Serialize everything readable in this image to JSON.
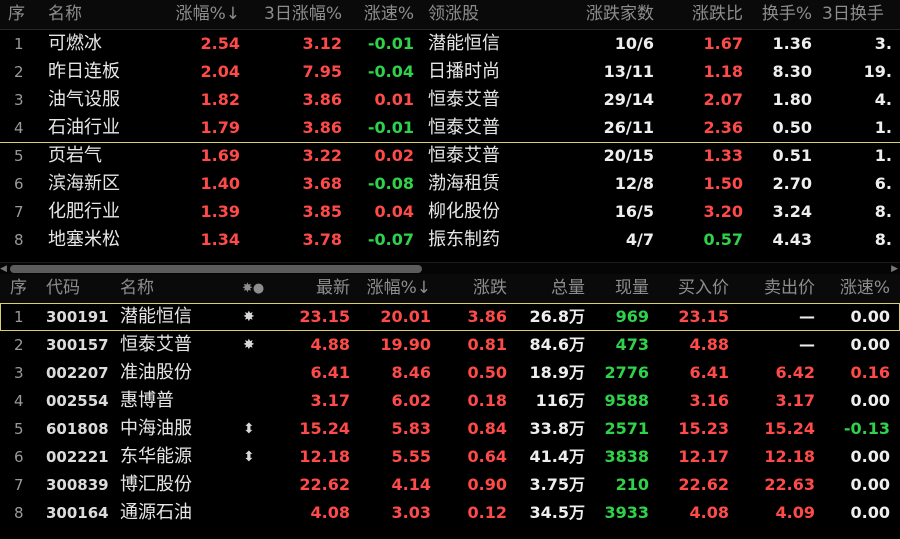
{
  "sector_table": {
    "headers": {
      "idx": "序",
      "name": "名称",
      "chg": "涨幅%↓",
      "chg3": "3日涨幅%",
      "speed": "涨速%",
      "leader": "领涨股",
      "updown": "涨跌家数",
      "ratio": "涨跌比",
      "turnover": "换手%",
      "turnover3": "3日换手"
    },
    "rows": [
      {
        "idx": "1",
        "name": "可燃冰",
        "chg": "2.54",
        "chg3": "3.12",
        "speed": "-0.01",
        "leader": "潜能恒信",
        "updown": "10/6",
        "ratio": "1.67",
        "turnover": "1.36",
        "turnover3": "3."
      },
      {
        "idx": "2",
        "name": "昨日连板",
        "chg": "2.04",
        "chg3": "7.95",
        "speed": "-0.04",
        "leader": "日播时尚",
        "updown": "13/11",
        "ratio": "1.18",
        "turnover": "8.30",
        "turnover3": "19."
      },
      {
        "idx": "3",
        "name": "油气设服",
        "chg": "1.82",
        "chg3": "3.86",
        "speed": "0.01",
        "leader": "恒泰艾普",
        "updown": "29/14",
        "ratio": "2.07",
        "turnover": "1.80",
        "turnover3": "4."
      },
      {
        "idx": "4",
        "name": "石油行业",
        "chg": "1.79",
        "chg3": "3.86",
        "speed": "-0.01",
        "leader": "恒泰艾普",
        "updown": "26/11",
        "ratio": "2.36",
        "turnover": "0.50",
        "turnover3": "1."
      },
      {
        "idx": "5",
        "name": "页岩气",
        "chg": "1.69",
        "chg3": "3.22",
        "speed": "0.02",
        "leader": "恒泰艾普",
        "updown": "20/15",
        "ratio": "1.33",
        "turnover": "0.51",
        "turnover3": "1."
      },
      {
        "idx": "6",
        "name": "滨海新区",
        "chg": "1.40",
        "chg3": "3.68",
        "speed": "-0.08",
        "leader": "渤海租赁",
        "updown": "12/8",
        "ratio": "1.50",
        "turnover": "2.70",
        "turnover3": "6."
      },
      {
        "idx": "7",
        "name": "化肥行业",
        "chg": "1.39",
        "chg3": "3.85",
        "speed": "0.04",
        "leader": "柳化股份",
        "updown": "16/5",
        "ratio": "3.20",
        "turnover": "3.24",
        "turnover3": "8."
      },
      {
        "idx": "8",
        "name": "地塞米松",
        "chg": "1.34",
        "chg3": "3.78",
        "speed": "-0.07",
        "leader": "振东制药",
        "updown": "4/7",
        "ratio": "0.57",
        "turnover": "4.43",
        "turnover3": "8."
      }
    ]
  },
  "stock_table": {
    "headers": {
      "idx": "序",
      "code": "代码",
      "name": "名称",
      "flag": "✸●",
      "last": "最新",
      "chg": "涨幅%↓",
      "change": "涨跌",
      "vol": "总量",
      "cur": "现量",
      "bid": "买入价",
      "ask": "卖出价",
      "speed": "涨速%"
    },
    "rows": [
      {
        "idx": "1",
        "code": "300191",
        "name": "潜能恒信",
        "flag": "✸",
        "last": "23.15",
        "chg": "20.01",
        "change": "3.86",
        "vol": "26.8万",
        "cur": "969",
        "bid": "23.15",
        "ask": "—",
        "speed": "0.00"
      },
      {
        "idx": "2",
        "code": "300157",
        "name": "恒泰艾普",
        "flag": "✸",
        "last": "4.88",
        "chg": "19.90",
        "change": "0.81",
        "vol": "84.6万",
        "cur": "473",
        "bid": "4.88",
        "ask": "—",
        "speed": "0.00"
      },
      {
        "idx": "3",
        "code": "002207",
        "name": "准油股份",
        "flag": "",
        "last": "6.41",
        "chg": "8.46",
        "change": "0.50",
        "vol": "18.9万",
        "cur": "2776",
        "bid": "6.41",
        "ask": "6.42",
        "speed": "0.16"
      },
      {
        "idx": "4",
        "code": "002554",
        "name": "惠博普",
        "flag": "",
        "last": "3.17",
        "chg": "6.02",
        "change": "0.18",
        "vol": "116万",
        "cur": "9588",
        "bid": "3.16",
        "ask": "3.17",
        "speed": "0.00"
      },
      {
        "idx": "5",
        "code": "601808",
        "name": "中海油服",
        "flag": "⬍",
        "last": "15.24",
        "chg": "5.83",
        "change": "0.84",
        "vol": "33.8万",
        "cur": "2571",
        "bid": "15.23",
        "ask": "15.24",
        "speed": "-0.13"
      },
      {
        "idx": "6",
        "code": "002221",
        "name": "东华能源",
        "flag": "⬍",
        "last": "12.18",
        "chg": "5.55",
        "change": "0.64",
        "vol": "41.4万",
        "cur": "3838",
        "bid": "12.17",
        "ask": "12.18",
        "speed": "0.00"
      },
      {
        "idx": "7",
        "code": "300839",
        "name": "博汇股份",
        "flag": "",
        "last": "22.62",
        "chg": "4.14",
        "change": "0.90",
        "vol": "3.75万",
        "cur": "210",
        "bid": "22.62",
        "ask": "22.63",
        "speed": "0.00"
      },
      {
        "idx": "8",
        "code": "300164",
        "name": "通源石油",
        "flag": "",
        "last": "4.08",
        "chg": "3.03",
        "change": "0.12",
        "vol": "34.5万",
        "cur": "3933",
        "bid": "4.08",
        "ask": "4.09",
        "speed": "0.00"
      }
    ]
  },
  "colors": {
    "up": "#ff4a4a",
    "down": "#2fd24a",
    "flat": "#eeeeee",
    "selection": "#d9d06a"
  },
  "scrollbar": {
    "arrow_left": "◀",
    "arrow_right": "▶"
  }
}
